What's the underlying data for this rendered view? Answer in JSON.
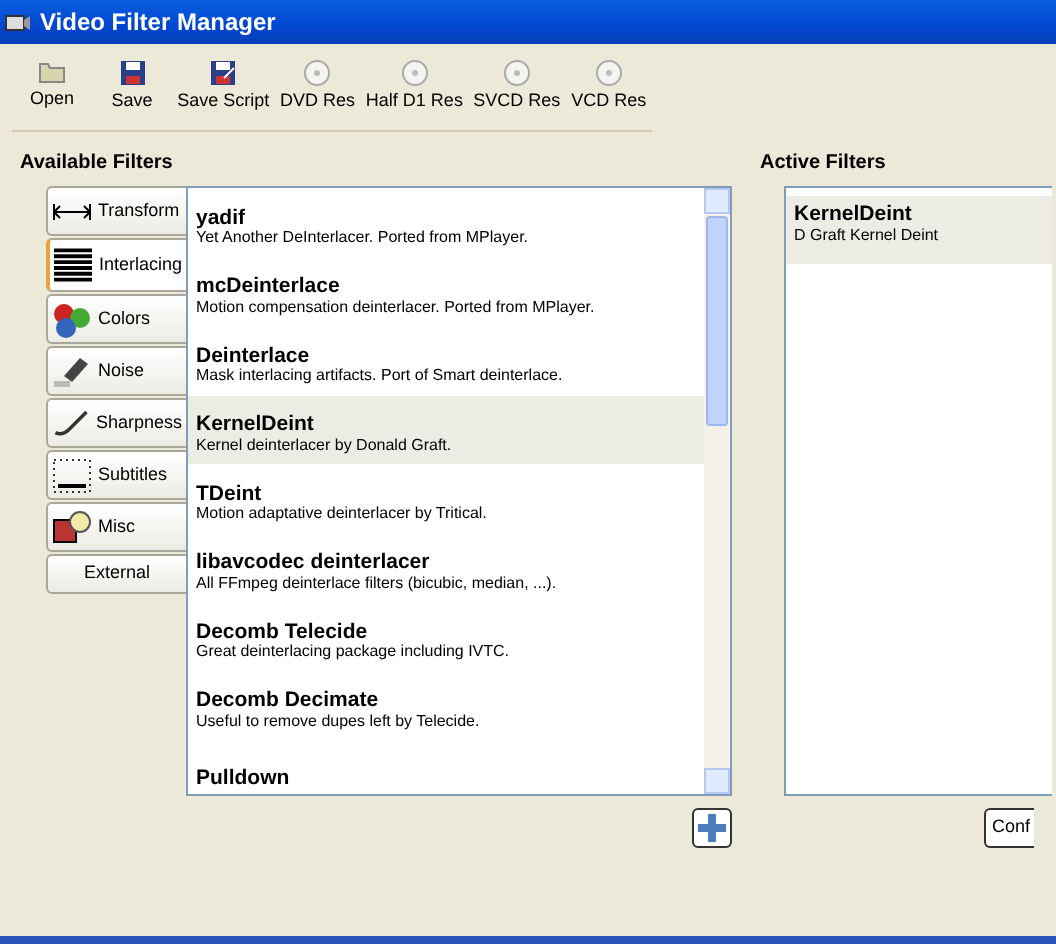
{
  "window": {
    "title": "Video Filter Manager"
  },
  "toolbar": [
    "Open",
    "Save",
    "Save Script",
    "DVD Res",
    "Half D1 Res",
    "SVCD Res",
    "VCD Res"
  ],
  "available": {
    "label": "Available Filters",
    "categories": [
      {
        "label": "Transform",
        "kind": "icon",
        "selected": false
      },
      {
        "label": "Interlacing",
        "kind": "icon",
        "selected": true
      },
      {
        "label": "Colors",
        "kind": "icon",
        "selected": false
      },
      {
        "label": "Noise",
        "kind": "icon",
        "selected": false
      },
      {
        "label": "Sharpness",
        "kind": "icon",
        "selected": false
      },
      {
        "label": "Subtitles",
        "kind": "icon",
        "selected": false
      },
      {
        "label": "Misc",
        "kind": "icon",
        "selected": false
      },
      {
        "label": "External",
        "kind": "text",
        "selected": false
      }
    ],
    "filters": [
      {
        "name": "yadif",
        "description": "Yet Another DeInterlacer. Ported from MPlayer.",
        "selected": false
      },
      {
        "name": "mcDeinterlace",
        "description": "Motion compensation deinterlacer. Ported from MPlayer.",
        "selected": false
      },
      {
        "name": "Deinterlace",
        "description": "Mask interlacing artifacts. Port of Smart deinterlace.",
        "selected": false
      },
      {
        "name": "KernelDeint",
        "description": "Kernel deinterlacer by Donald Graft.",
        "selected": true
      },
      {
        "name": "TDeint",
        "description": "Motion adaptative deinterlacer by Tritical.",
        "selected": false
      },
      {
        "name": "libavcodec deinterlacer",
        "description": "All FFmpeg deinterlace filters (bicubic, median, ...).",
        "selected": false
      },
      {
        "name": "Decomb Telecide",
        "description": "Great deinterlacing package including IVTC.",
        "selected": false
      },
      {
        "name": "Decomb Decimate",
        "description": "Useful to remove dupes left by Telecide.",
        "selected": false
      },
      {
        "name": "Pulldown",
        "selected": false
      }
    ]
  },
  "active": {
    "label": "Active Filters",
    "filters": [
      {
        "name": "KernelDeint",
        "description": "D Graft Kernel Deint"
      }
    ],
    "config_button": "Conf"
  }
}
